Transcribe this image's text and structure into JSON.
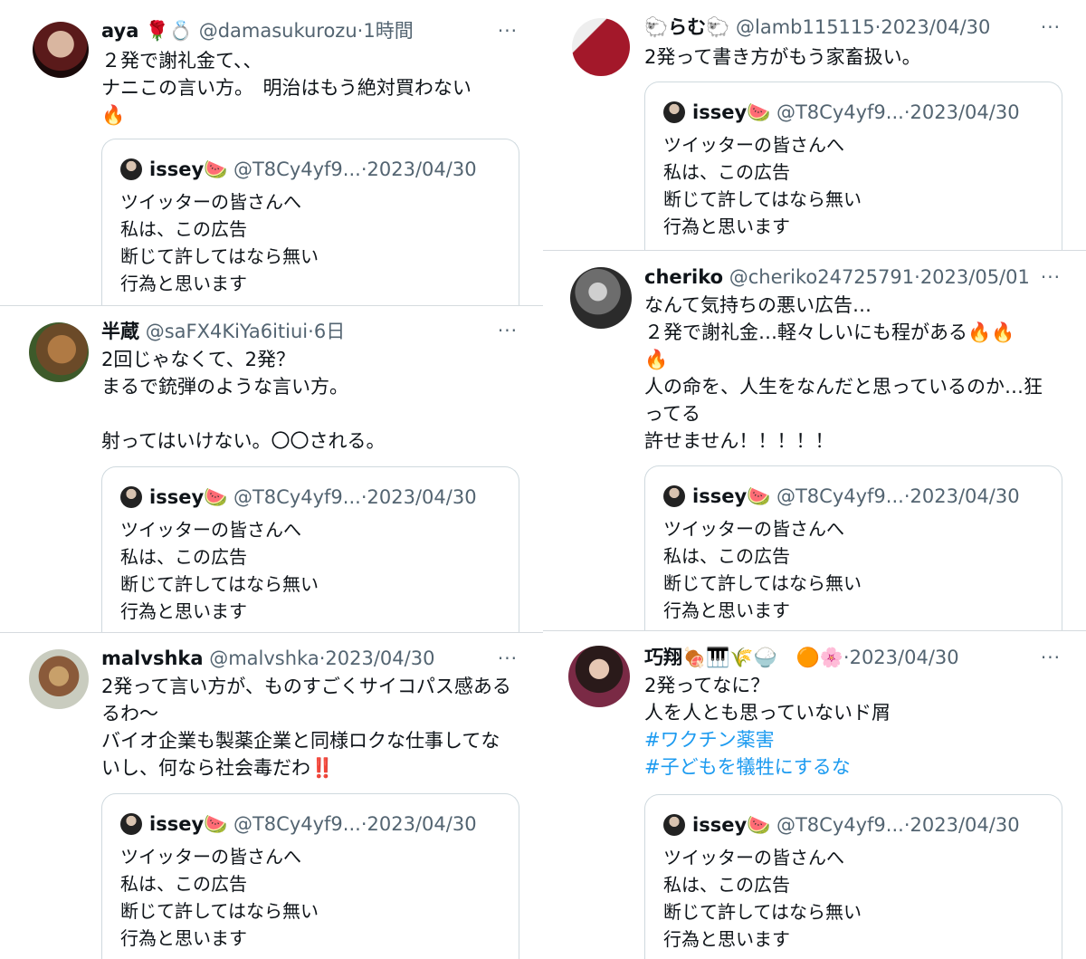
{
  "tweets": [
    {
      "name": "aya 🌹💍",
      "handle": "@damasukurozu",
      "time": "1時間",
      "lines": [
        "２発で謝礼金て、、",
        "ナニこの言い方。　明治はもう絶対買わない",
        "🔥"
      ],
      "quote": {
        "name": "issey🍉",
        "handle": "@T8Cy4yf9...",
        "time": "2023/04/30",
        "lines": [
          "ツイッターの皆さんへ",
          "私は、この広告",
          "断じて許してはなら無い",
          "行為と思います"
        ]
      }
    },
    {
      "name": "🐑らむ🐑",
      "handle": "@lamb115115",
      "time": "2023/04/30",
      "lines": [
        "2発って書き方がもう家畜扱い。"
      ],
      "quote": {
        "name": "issey🍉",
        "handle": "@T8Cy4yf9...",
        "time": "2023/04/30",
        "lines": [
          "ツイッターの皆さんへ",
          "私は、この広告",
          "断じて許してはなら無い",
          "行為と思います"
        ]
      }
    },
    {
      "name": "半蔵",
      "handle": "@saFX4KiYa6itiui",
      "time": "6日",
      "lines": [
        "2回じゃなくて、2発？",
        "まるで銃弾のような言い方。",
        "",
        "射ってはいけない。〇〇される。"
      ],
      "quote": {
        "name": "issey🍉",
        "handle": "@T8Cy4yf9...",
        "time": "2023/04/30",
        "lines": [
          "ツイッターの皆さんへ",
          "私は、この広告",
          "断じて許してはなら無い",
          "行為と思います"
        ]
      }
    },
    {
      "name": "cheriko",
      "handle": "@cheriko24725791",
      "time": "2023/05/01",
      "lines": [
        "なんて気持ちの悪い広告…",
        "２発で謝礼金…軽々しいにも程がある🔥🔥",
        "🔥",
        "人の命を、人生をなんだと思っているのか…狂",
        "ってる",
        "許せません！！！！！"
      ],
      "quote": {
        "name": "issey🍉",
        "handle": "@T8Cy4yf9...",
        "time": "2023/04/30",
        "lines": [
          "ツイッターの皆さんへ",
          "私は、この広告",
          "断じて許してはなら無い",
          "行為と思います"
        ]
      }
    },
    {
      "name": "malvshka",
      "handle": "@malvshka",
      "time": "2023/04/30",
      "lines": [
        "2発って言い方が、ものすごくサイコパス感ある",
        "るわ〜",
        "バイオ企業も製薬企業と同様ロクな仕事してな",
        "いし、何なら社会毒だわ‼️"
      ],
      "quote": {
        "name": "issey🍉",
        "handle": "@T8Cy4yf9...",
        "time": "2023/04/30",
        "lines": [
          "ツイッターの皆さんへ",
          "私は、この広告",
          "断じて許してはなら無い",
          "行為と思います"
        ]
      }
    },
    {
      "name": "巧翔🍖🎹🌾🍚　🟠🌸",
      "handle": "",
      "time": "2023/04/30",
      "lines": [
        "2発ってなに？",
        "人を人とも思っていないド屑"
      ],
      "hashtags": [
        "#ワクチン薬害",
        "#子どもを犠牲にするな"
      ],
      "quote": {
        "name": "issey🍉",
        "handle": "@T8Cy4yf9...",
        "time": "2023/04/30",
        "lines": [
          "ツイッターの皆さんへ",
          "私は、この広告",
          "断じて許してはなら無い",
          "行為と思います"
        ]
      }
    }
  ],
  "more_glyph": "···",
  "dot_glyph": "·"
}
